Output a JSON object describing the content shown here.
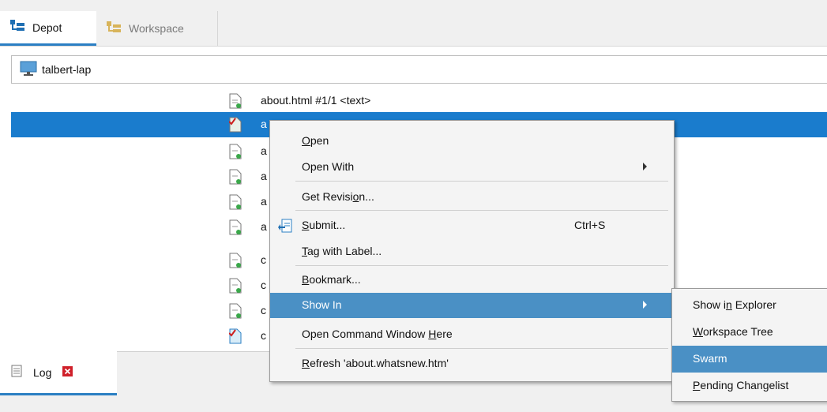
{
  "tabs": [
    {
      "label": "Depot",
      "active": true,
      "icon": "depot-tree-icon"
    },
    {
      "label": "Workspace",
      "active": false,
      "icon": "workspace-tree-icon"
    }
  ],
  "workspace": {
    "name": "talbert-lap",
    "icon": "computer-monitor-icon"
  },
  "files": {
    "first_row": "about.html #1/1 <text>",
    "truncated_prefixes": [
      "a",
      "a",
      "a",
      "a",
      "a",
      "c",
      "c",
      "c",
      "c"
    ]
  },
  "context_menu": {
    "items": [
      {
        "label": "Open",
        "underline_index": 0
      },
      {
        "label": "Open With",
        "has_submenu": true
      },
      {
        "label": "Get Revision...",
        "underline_index": 10
      },
      {
        "label": "Submit...",
        "shortcut": "Ctrl+S",
        "icon": "submit-icon",
        "underline_index": 0
      },
      {
        "label": "Tag with Label...",
        "underline_index": 0
      },
      {
        "label": "Bookmark...",
        "underline_index": 0
      },
      {
        "label": "Show In",
        "has_submenu": true,
        "highlighted": true
      },
      {
        "label": "Open Command Window Here",
        "underline_index": 20
      },
      {
        "label": "Refresh 'about.whatsnew.htm'",
        "underline_index": 0
      }
    ]
  },
  "submenu": {
    "items": [
      {
        "label": "Show in Explorer",
        "underline_index": 6
      },
      {
        "label": "Workspace Tree",
        "underline_index": 0
      },
      {
        "label": "Swarm",
        "highlighted": true
      },
      {
        "label": "Pending Changelist",
        "underline_index": 0
      }
    ]
  },
  "bottom_panel": {
    "tab_label": "Log",
    "icon": "log-icon",
    "close_icon": "close-icon"
  },
  "colors": {
    "selection": "#1a7ccd",
    "menu_highlight": "#4a90c5",
    "tab_underline": "#2b7fc3",
    "close_red": "#d0202a"
  }
}
